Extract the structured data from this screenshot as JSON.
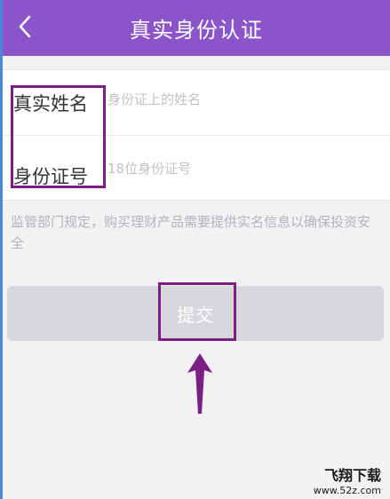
{
  "header": {
    "title": "真实身份认证",
    "back_icon": "chevron-left-icon"
  },
  "form": {
    "name": {
      "label": "真实姓名",
      "placeholder": "身份证上的姓名"
    },
    "id_number": {
      "label": "身份证号",
      "placeholder": "18位身份证号"
    }
  },
  "notice": "监管部门规定，购买理财产品需要提供实名信息以确保投资安全",
  "submit": {
    "label": "提交"
  },
  "watermark": {
    "title": "飞翔下载",
    "url": "www.52z.com"
  },
  "colors": {
    "header_bg": "#8b55c9",
    "annotation": "#7c1f84",
    "button_disabled": "#d8d8dc"
  }
}
